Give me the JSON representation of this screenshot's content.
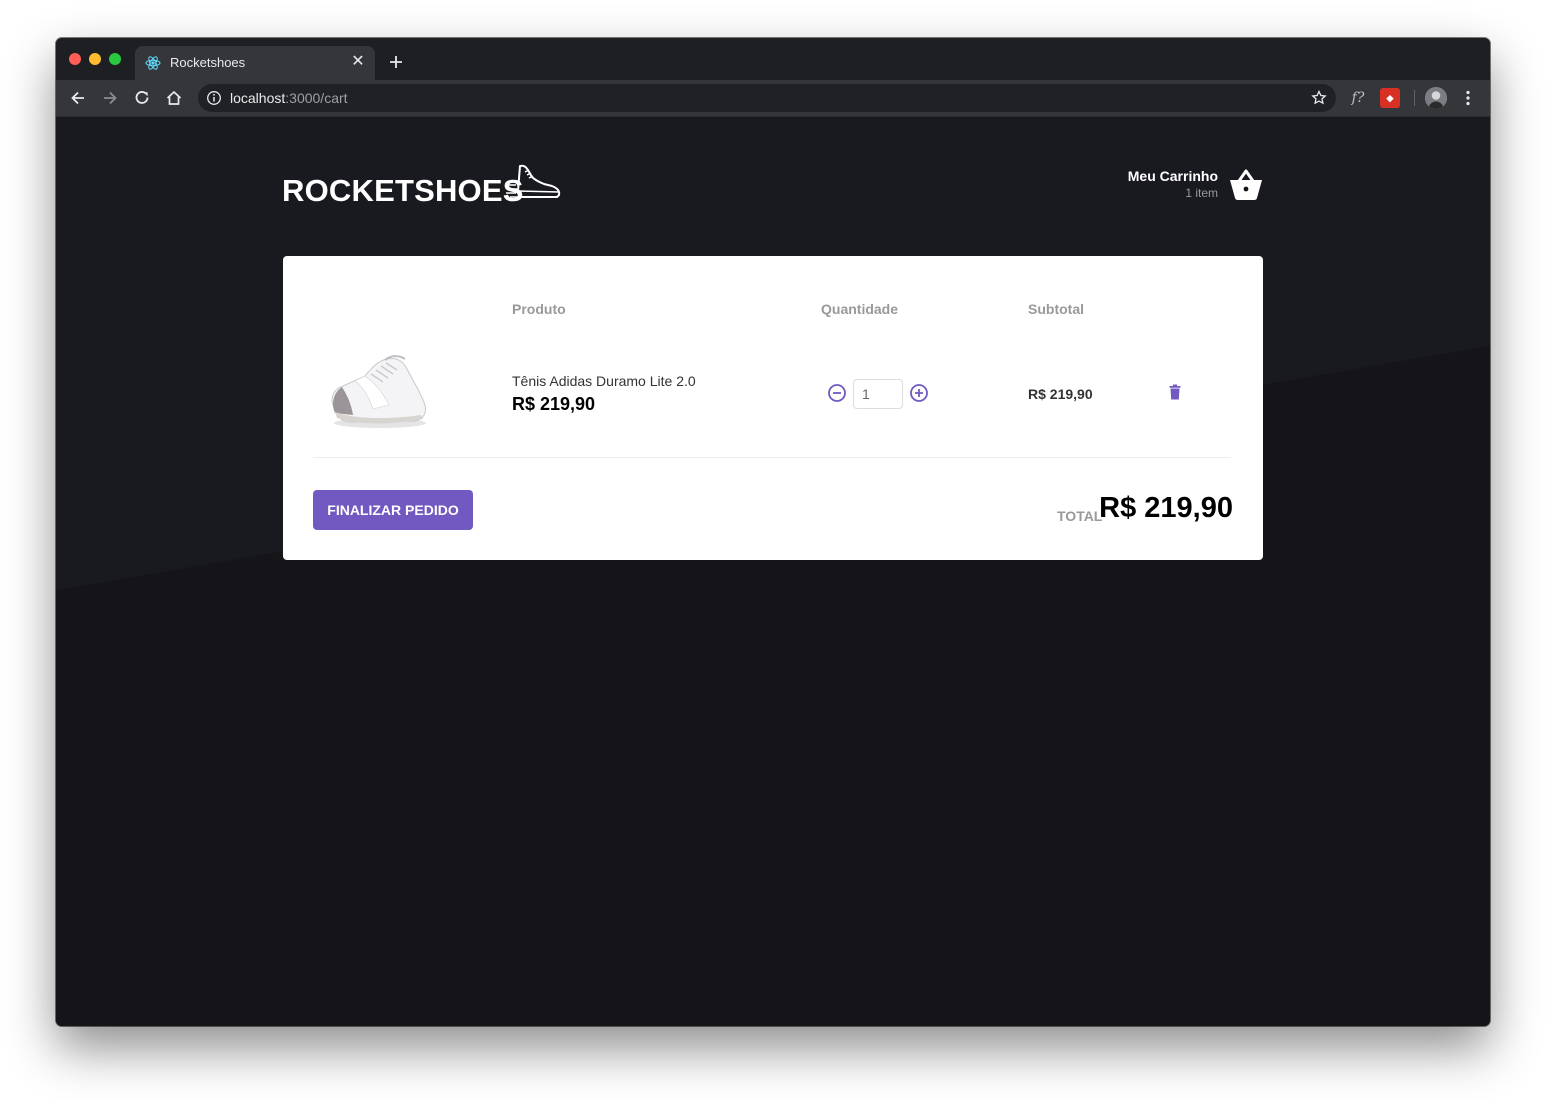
{
  "browser": {
    "tab_title": "Rocketshoes",
    "url_host": "localhost",
    "url_path": ":3000/cart"
  },
  "header": {
    "logo_text": "ROCKETSHOES",
    "cart_title": "Meu Carrinho",
    "cart_count": "1 item"
  },
  "cart": {
    "columns": {
      "product": "Produto",
      "quantity": "Quantidade",
      "subtotal": "Subtotal"
    },
    "items": [
      {
        "name": "Tênis Adidas Duramo Lite 2.0",
        "price": "R$ 219,90",
        "quantity": "1",
        "subtotal": "R$ 219,90"
      }
    ],
    "checkout_label": "FINALIZAR PEDIDO",
    "total_label": "TOTAL",
    "total_value": "R$ 219,90"
  },
  "colors": {
    "accent": "#7159c1",
    "page_background": "#141419",
    "card_background": "#ffffff"
  },
  "icons": {
    "logo": "running-shoe-icon",
    "cart": "shopping-basket-icon",
    "decrement": "minus-circle-icon",
    "increment": "plus-circle-icon",
    "delete": "trash-icon"
  }
}
